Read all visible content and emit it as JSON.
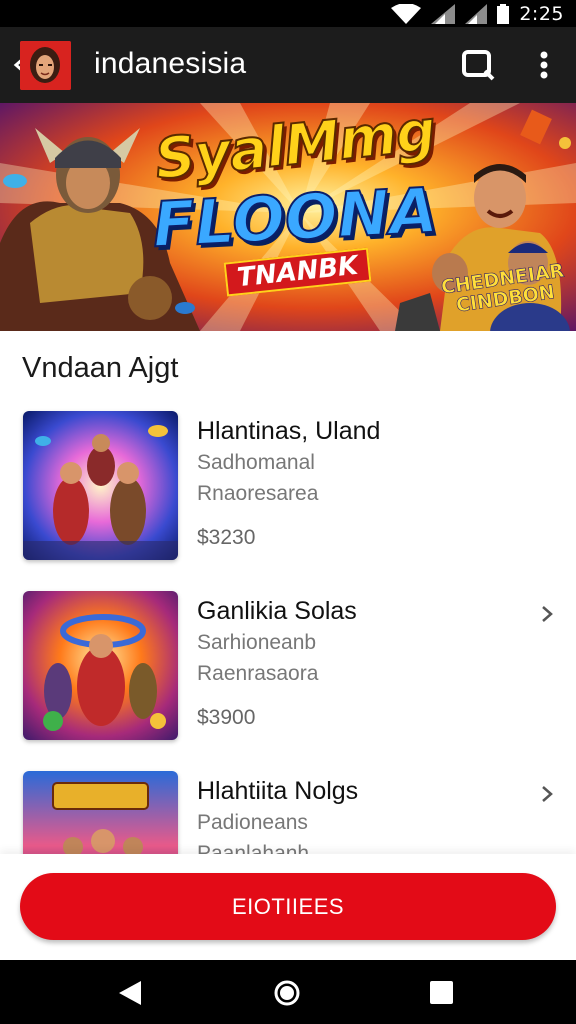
{
  "status_bar": {
    "time": "2:25"
  },
  "app_bar": {
    "title": "indanesisia"
  },
  "banner": {
    "title_line1": "SyalMmg",
    "title_line2": "FLOONA",
    "tag": "TNANBK",
    "badge_line1": "CHEDNEIAR",
    "badge_line2": "CINDBON"
  },
  "section": {
    "title": "Vndaan Ajgt"
  },
  "items": [
    {
      "name": "Hlantinas, Uland",
      "sub1": "Sadhomanal",
      "sub2": "Rnaoresarea",
      "price": "$3230",
      "chevron": false
    },
    {
      "name": "Ganlikia Solas",
      "sub1": "Sarhioneanb",
      "sub2": "Raenrasaora",
      "price": "$3900",
      "chevron": true
    },
    {
      "name": "Hlahtiita Nolgs",
      "sub1": "Padioneans",
      "sub2": "Paanlahanh",
      "price": "",
      "chevron": true
    }
  ],
  "cta": {
    "label": "EIOTIIEES"
  },
  "colors": {
    "accent": "#e30b17",
    "appbar": "#1c1c1c"
  },
  "icons": [
    "wifi-icon",
    "signal-icon",
    "battery-icon",
    "back-arrow-icon",
    "search-icon",
    "more-vert-icon",
    "chevron-right-icon",
    "nav-back-icon",
    "nav-home-icon",
    "nav-recents-icon"
  ]
}
